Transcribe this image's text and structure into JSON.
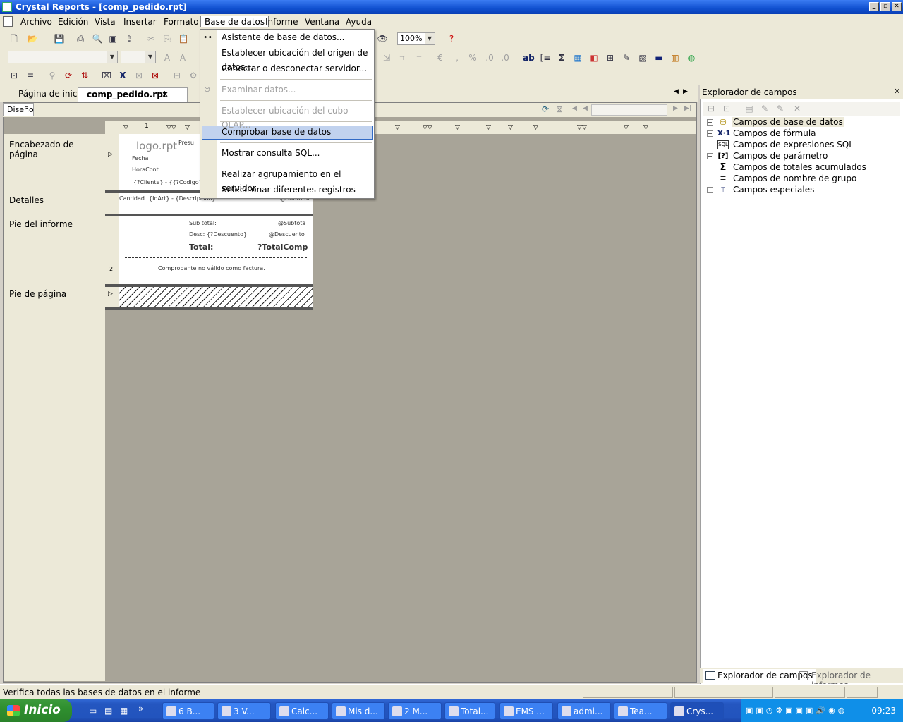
{
  "window": {
    "title": "Crystal Reports - [comp_pedido.rpt]"
  },
  "menubar": {
    "items": [
      "Archivo",
      "Edición",
      "Vista",
      "Insertar",
      "Formato",
      "Base de datos",
      "Informe",
      "Ventana",
      "Ayuda"
    ],
    "active": "Base de datos"
  },
  "toolbar": {
    "zoom": "100%"
  },
  "tabs": {
    "start_page": "Página de inicio",
    "document": "comp_pedido.rpt",
    "close": "✕"
  },
  "design": {
    "tab": "Diseño",
    "sections": [
      "Encabezado de página",
      "Detalles",
      "Pie del informe",
      "Pie de página"
    ],
    "ruler_numbers": [
      "1",
      "2"
    ],
    "fields": {
      "logo": "logo.rpt",
      "presu": "Presu",
      "fecha": "Fecha",
      "hora": "HoraCont",
      "cliente": "{?Cliente} - {{?Codigo}}",
      "cantidad": "Cantidad",
      "articulo": "{IdArt} - {Descripcion}",
      "subtotal_field": "@Subtotal",
      "subtotal_label": "Sub total:",
      "subtotal_value": "@Subtota",
      "desc_label": "Desc: {?Descuento}",
      "desc_value": "@Descuento",
      "total_label": "Total:",
      "total_value": "?TotalComp",
      "note": "Comprobante no válido como factura."
    }
  },
  "dropdown": {
    "items": [
      {
        "label": "Asistente de base de datos...",
        "enabled": true
      },
      {
        "label": "Establecer ubicación del origen de datos...",
        "enabled": true
      },
      {
        "label": "Conectar o desconectar servidor...",
        "enabled": true
      },
      {
        "label": "Examinar datos...",
        "enabled": false
      },
      {
        "label": "Establecer ubicación del cubo OLAP...",
        "enabled": false
      },
      {
        "label": "Comprobar base de datos",
        "enabled": true,
        "highlighted": true
      },
      {
        "label": "Mostrar consulta SQL...",
        "enabled": true
      },
      {
        "label": "Realizar agrupamiento en el servidor",
        "enabled": true
      },
      {
        "label": "Seleccionar diferentes registros",
        "enabled": true
      }
    ]
  },
  "field_explorer": {
    "title": "Explorador de campos",
    "items": [
      {
        "label": "Campos de base de datos",
        "expandable": true,
        "icon": "database-icon"
      },
      {
        "label": "Campos de fórmula",
        "expandable": true,
        "icon": "formula-icon"
      },
      {
        "label": "Campos de expresiones SQL",
        "expandable": false,
        "icon": "sql-icon"
      },
      {
        "label": "Campos de parámetro",
        "expandable": true,
        "icon": "parameter-icon"
      },
      {
        "label": "Campos de totales acumulados",
        "expandable": false,
        "icon": "sigma-icon"
      },
      {
        "label": "Campos de nombre de grupo",
        "expandable": false,
        "icon": "group-icon"
      },
      {
        "label": "Campos especiales",
        "expandable": true,
        "icon": "special-icon"
      }
    ],
    "bottom_tabs": [
      "Explorador de campos",
      "Explorador de informes"
    ]
  },
  "statusbar": {
    "text": "Verifica todas las bases de datos en el informe"
  },
  "taskbar": {
    "start": "Inicio",
    "tasks": [
      "6 B...",
      "3 V...",
      "Calc...",
      "Mis d...",
      "2 M...",
      "Total...",
      "EMS ...",
      "admi...",
      "Tea...",
      "Crys..."
    ],
    "clock": "09:23"
  }
}
